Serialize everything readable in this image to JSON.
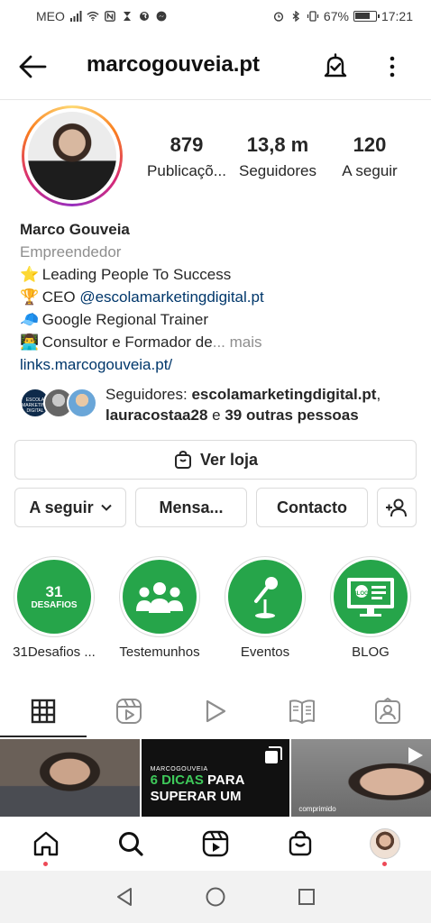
{
  "status_bar": {
    "carrier": "MEO",
    "battery": "67%",
    "time": "17:21"
  },
  "header": {
    "username": "marcogouveia.pt"
  },
  "stats": [
    {
      "value": "879",
      "label": "Publicaçõ..."
    },
    {
      "value": "13,8 m",
      "label": "Seguidores"
    },
    {
      "value": "120",
      "label": "A seguir"
    }
  ],
  "bio": {
    "name": "Marco Gouveia",
    "category": "Empreendedor",
    "line1": "Leading People To Success",
    "line2_prefix": "CEO",
    "line2_mention": "@escolamarketingdigital.pt",
    "line3": "Google Regional Trainer",
    "line4": "Consultor e Formador de",
    "ellipsis": "...",
    "more": "mais",
    "link": "links.marcogouveia.pt/"
  },
  "followers": {
    "prefix": "Seguidores:",
    "user1": "escolamarketingdigital.pt",
    "sep1": ",",
    "user2": "lauracostaa28",
    "connector": "e",
    "others": "39 outras pessoas",
    "avatar1_text": "ESCOLA MARKETING DIGITAL"
  },
  "buttons": {
    "shop": "Ver loja",
    "following": "A seguir",
    "message": "Mensa...",
    "contact": "Contacto"
  },
  "highlights": [
    {
      "label": "31Desafios ...",
      "cover_big": "31",
      "cover_small": "DESAFIOS"
    },
    {
      "label": "Testemunhos"
    },
    {
      "label": "Eventos"
    },
    {
      "label": "BLOG",
      "cover_small": "BLOG"
    }
  ],
  "grid": {
    "tile2_brand": "MARCOGOUVEIA",
    "tile2_line1_green": "6 DICAS",
    "tile2_line1_rest": "PARA",
    "tile2_line2": "SUPERAR UM",
    "tile3_caption": "comprimido"
  },
  "colors": {
    "accent_green": "#26a54a",
    "link": "#00376b",
    "notification_dot": "#ed4956"
  },
  "icons": {
    "status": [
      "signal-icon",
      "wifi-icon",
      "nfc-icon",
      "hourglass-icon",
      "app-icon",
      "messenger-icon",
      "alarm-icon",
      "bluetooth-icon",
      "vibrate-icon",
      "battery-icon"
    ],
    "nav": [
      "home-icon",
      "search-icon",
      "reels-icon",
      "shop-icon",
      "profile-avatar"
    ]
  }
}
